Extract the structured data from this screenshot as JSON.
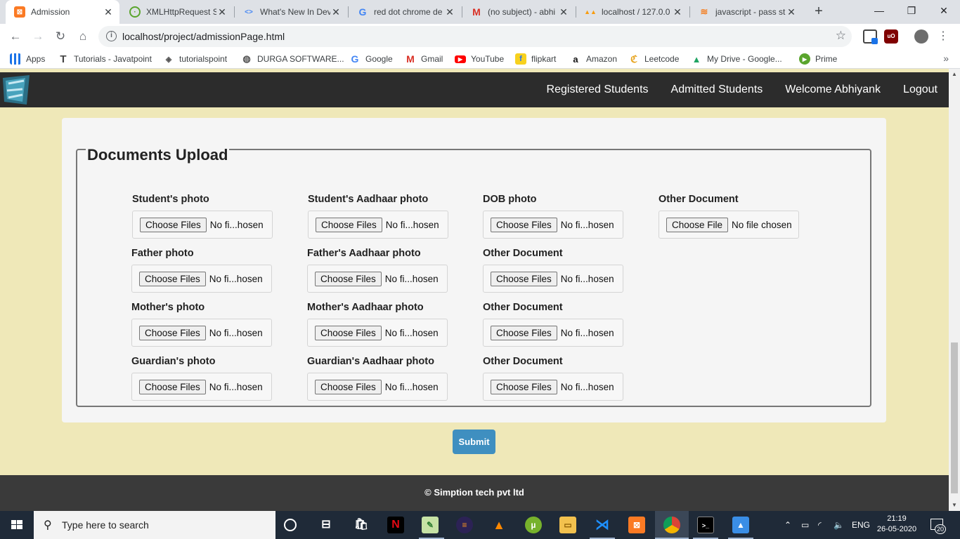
{
  "browser": {
    "tabs": [
      {
        "title": "Admission",
        "icon": "xampp-icon",
        "color": "#fb7a24"
      },
      {
        "title": "XMLHttpRequest S",
        "icon": "tab-green-icon",
        "color": "#5aa52d"
      },
      {
        "title": "What's New In Dev",
        "icon": "devtools-icon",
        "color": "#4285f4"
      },
      {
        "title": "red dot chrome de",
        "icon": "google-icon",
        "color": "#4285f4"
      },
      {
        "title": "(no subject) - abhi",
        "icon": "gmail-icon",
        "color": "#d93025"
      },
      {
        "title": "localhost / 127.0.0",
        "icon": "phpmyadmin-icon",
        "color": "#f89c0e"
      },
      {
        "title": "javascript - pass st",
        "icon": "stackoverflow-icon",
        "color": "#f48024"
      }
    ],
    "new_tab": "+",
    "url": "localhost/project/admissionPage.html",
    "bookmarks": [
      {
        "label": "Apps",
        "icon": "apps-grid-icon"
      },
      {
        "label": "Tutorials - Javatpoint",
        "icon": "javatpoint-icon"
      },
      {
        "label": "tutorialspoint",
        "icon": "tutorialspoint-icon"
      },
      {
        "label": "DURGA SOFTWARE...",
        "icon": "globe-icon"
      },
      {
        "label": "Google",
        "icon": "google-icon"
      },
      {
        "label": "Gmail",
        "icon": "gmail-icon"
      },
      {
        "label": "YouTube",
        "icon": "youtube-icon"
      },
      {
        "label": "flipkart",
        "icon": "flipkart-icon"
      },
      {
        "label": "Amazon",
        "icon": "amazon-icon"
      },
      {
        "label": "Leetcode",
        "icon": "leetcode-icon"
      },
      {
        "label": "My Drive - Google...",
        "icon": "drive-icon"
      },
      {
        "label": "Prime",
        "icon": "prime-icon"
      }
    ]
  },
  "site": {
    "nav": [
      "Registered Students",
      "Admitted Students",
      "Welcome Abhiyank",
      "Logout"
    ],
    "section_title": "Documents Upload",
    "choose_files": "Choose Files",
    "choose_file": "Choose File",
    "no_files_short": "No fi...hosen",
    "no_file_chosen": "No file chosen",
    "fields": {
      "student_photo": "Student's photo",
      "student_aadhaar": "Student's Aadhaar photo",
      "dob_photo": "DOB photo",
      "other_doc": "Other Document",
      "father_photo": "Father photo",
      "father_aadhaar": "Father's Aadhaar photo",
      "mother_photo": "Mother's photo",
      "mother_aadhaar": "Mother's Aadhaar photo",
      "guardian_photo": "Guardian's photo",
      "guardian_aadhaar": "Guardian's Aadhaar photo"
    },
    "submit": "Submit",
    "footer": "© Simption tech pvt ltd",
    "colors": {
      "page_bg": "#efe8b8",
      "nav_bg": "#2c2c2c",
      "submit_bg": "#3f8fc0",
      "footer_bg": "#3a3a3a"
    }
  },
  "taskbar": {
    "search_placeholder": "Type here to search",
    "language": "ENG",
    "time": "21:19",
    "date": "26-05-2020",
    "notifications": "20"
  }
}
